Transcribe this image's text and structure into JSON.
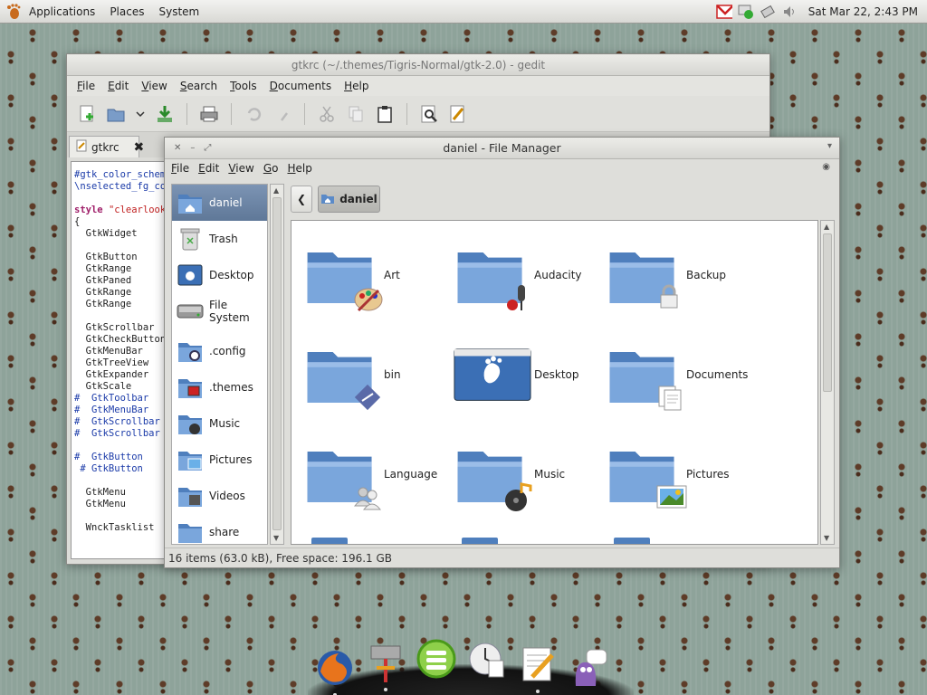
{
  "top_panel": {
    "menus": [
      "Applications",
      "Places",
      "System"
    ],
    "clock": "Sat Mar 22,  2:43 PM",
    "tray_icons": [
      "gmail-icon",
      "network-status-icon",
      "network-icon",
      "volume-icon"
    ]
  },
  "gedit": {
    "title": "gtkrc (~/.themes/Tigris-Normal/gtk-2.0) - gedit",
    "menus": [
      "File",
      "Edit",
      "View",
      "Search",
      "Tools",
      "Documents",
      "Help"
    ],
    "toolbar_icons": [
      "new-document-icon",
      "open-icon",
      "open-dropdown-icon",
      "save-icon",
      "print-icon",
      "undo-icon",
      "redo-icon",
      "cut-icon",
      "copy-icon",
      "paste-icon",
      "find-icon",
      "replace-icon"
    ],
    "tab_label": "gtkrc",
    "code_lines": [
      "#gtk_color_scheme",
      "\\nselected_fg_col",
      "",
      "style \"clearlooks",
      "{",
      "  GtkWidget",
      "",
      "  GtkButton",
      "  GtkRange",
      "  GtkPaned",
      "  GtkRange",
      "  GtkRange",
      "",
      "  GtkScrollbar",
      "  GtkCheckButton",
      "  GtkMenuBar",
      "  GtkTreeView",
      "  GtkExpander",
      "  GtkScale",
      "#  GtkToolbar",
      "#  GtkMenuBar",
      "#  GtkScrollbar",
      "#  GtkScrollbar",
      "",
      "#  GtkButton",
      " # GtkButton",
      "",
      "  GtkMenu",
      "  GtkMenu",
      "",
      "  WnckTasklist"
    ]
  },
  "file_manager": {
    "title": "daniel - File Manager",
    "menus": [
      "File",
      "Edit",
      "View",
      "Go",
      "Help"
    ],
    "sidebar": [
      {
        "label": "daniel",
        "icon": "home-folder-icon",
        "active": true
      },
      {
        "label": "Trash",
        "icon": "trash-icon",
        "active": false
      },
      {
        "label": "Desktop",
        "icon": "desktop-icon",
        "active": false
      },
      {
        "label": "File System",
        "icon": "drive-icon",
        "active": false
      },
      {
        "label": ".config",
        "icon": "config-folder-icon",
        "active": false
      },
      {
        "label": ".themes",
        "icon": "themes-folder-icon",
        "active": false
      },
      {
        "label": "Music",
        "icon": "music-folder-icon",
        "active": false
      },
      {
        "label": "Pictures",
        "icon": "pictures-folder-icon",
        "active": false
      },
      {
        "label": "Videos",
        "icon": "videos-folder-icon",
        "active": false
      },
      {
        "label": "share",
        "icon": "share-folder-icon",
        "active": false
      }
    ],
    "location": "daniel",
    "items": [
      {
        "label": "Art",
        "emblem": "palette-emblem-icon"
      },
      {
        "label": "Audacity",
        "emblem": "microphone-emblem-icon"
      },
      {
        "label": "Backup",
        "emblem": "lock-emblem-icon"
      },
      {
        "label": "bin",
        "emblem": "script-emblem-icon"
      },
      {
        "label": "Desktop",
        "emblem": "desktop-icon"
      },
      {
        "label": "Documents",
        "emblem": "documents-emblem-icon"
      },
      {
        "label": "Language",
        "emblem": "people-emblem-icon"
      },
      {
        "label": "Music",
        "emblem": "music-emblem-icon"
      },
      {
        "label": "Pictures",
        "emblem": "pictures-emblem-icon"
      }
    ],
    "status": "16 items (63.0 kB), Free space: 196.1 GB"
  },
  "dock": {
    "items": [
      "firefox-icon",
      "system-tools-icon",
      "evolution-icon",
      "clock-icon",
      "text-editor-icon",
      "pidgin-icon"
    ]
  },
  "colors": {
    "folder_blue": "#5a8ac8",
    "sidebar_active": "#6b84a6",
    "wallpaper": "#8ea39a"
  }
}
